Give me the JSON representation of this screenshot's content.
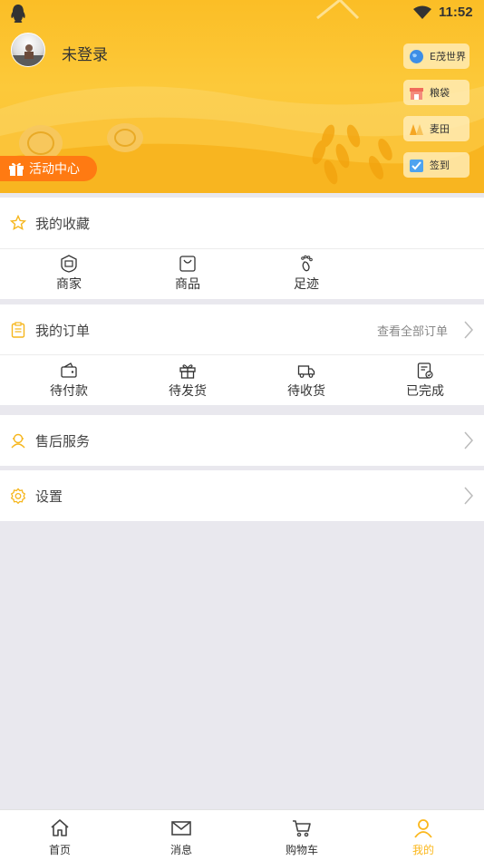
{
  "status_bar": {
    "time": "11:52"
  },
  "profile": {
    "login_status": "未登录"
  },
  "side_buttons": [
    {
      "label": "E茂世界",
      "icon": "globe-icon"
    },
    {
      "label": "粮袋",
      "icon": "shop-icon"
    },
    {
      "label": "麦田",
      "icon": "field-icon"
    },
    {
      "label": "签到",
      "icon": "checkin-icon"
    }
  ],
  "activity_center": {
    "label": "活动中心",
    "icon": "gift-icon"
  },
  "favorites": {
    "title": "我的收藏",
    "items": [
      {
        "label": "商家",
        "icon": "merchant-icon"
      },
      {
        "label": "商品",
        "icon": "bag-icon"
      },
      {
        "label": "足迹",
        "icon": "footprint-icon"
      }
    ]
  },
  "orders": {
    "title": "我的订单",
    "view_all": "查看全部订单",
    "items": [
      {
        "label": "待付款",
        "icon": "wallet-icon"
      },
      {
        "label": "待发货",
        "icon": "gift-box-icon"
      },
      {
        "label": "待收货",
        "icon": "truck-icon"
      },
      {
        "label": "已完成",
        "icon": "completed-icon"
      }
    ]
  },
  "after_sales": {
    "title": "售后服务"
  },
  "settings": {
    "title": "设置"
  },
  "tabbar": [
    {
      "label": "首页",
      "icon": "home-icon"
    },
    {
      "label": "消息",
      "icon": "mail-icon"
    },
    {
      "label": "购物车",
      "icon": "cart-icon"
    },
    {
      "label": "我的",
      "icon": "user-icon"
    }
  ],
  "colors": {
    "accent": "#fbb71b",
    "activity": "#ff7a12",
    "background": "#e9e8ee"
  }
}
